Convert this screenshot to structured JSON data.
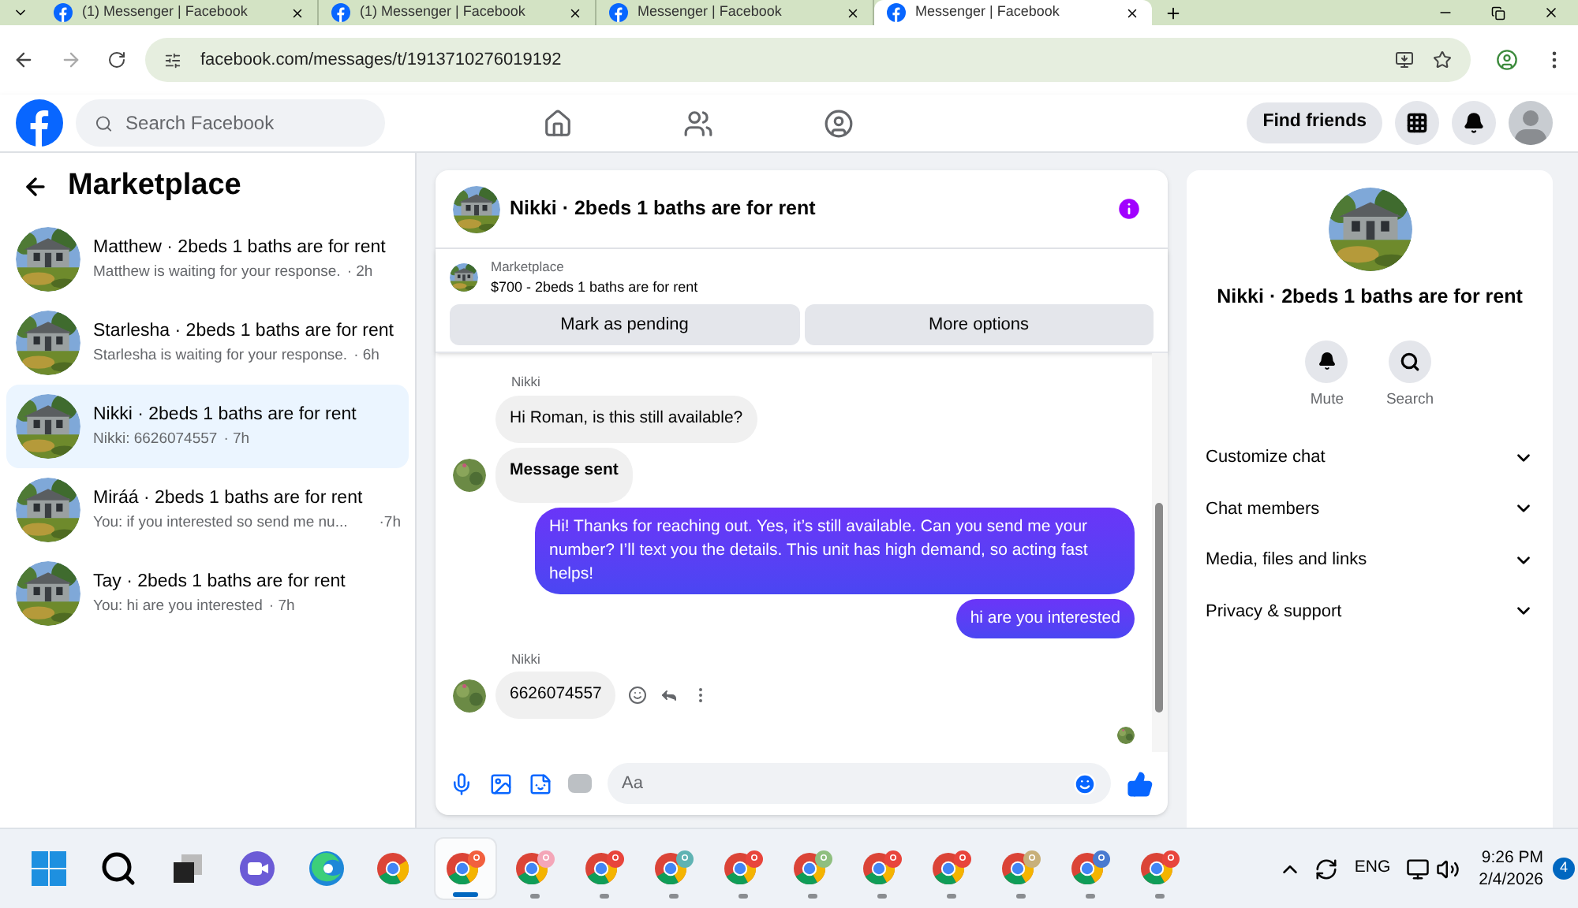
{
  "browser": {
    "tabs": [
      {
        "title": "(1) Messenger | Facebook",
        "selected": false
      },
      {
        "title": "(1) Messenger | Facebook",
        "selected": false
      },
      {
        "title": "Messenger | Facebook",
        "selected": false
      },
      {
        "title": "Messenger | Facebook",
        "selected": true
      }
    ],
    "url": "facebook.com/messages/t/1913710276019192"
  },
  "topbar": {
    "search": {
      "placeholder": "Search Facebook"
    },
    "find_friends": "Find friends"
  },
  "sidebar": {
    "title": "Marketplace",
    "conversations": [
      {
        "title": "Matthew · 2beds 1 baths are for rent",
        "preview": "Matthew is waiting for your response.",
        "time": "· 2h",
        "selected": false
      },
      {
        "title": "Starlesha · 2beds 1 baths are for rent",
        "preview": "Starlesha is waiting for your response.",
        "time": "· 6h",
        "selected": false
      },
      {
        "title": "Nikki · 2beds 1 baths are for rent",
        "preview": "Nikki: 6626074557",
        "time": "· 7h",
        "selected": true
      },
      {
        "title": "Miráá · 2beds 1 baths are for rent",
        "preview": "You: if you interested so send me nu...",
        "time": "·7h",
        "selected": false
      },
      {
        "title": "Tay · 2beds 1 baths are for rent",
        "preview": "You: hi are you interested",
        "time": "· 7h",
        "selected": false
      }
    ]
  },
  "chat": {
    "title": "Nikki · 2beds 1 baths are for rent",
    "listing": {
      "label": "Marketplace",
      "detail": "$700 - 2beds 1 baths are for rent"
    },
    "actions": [
      "Mark as pending",
      "More options"
    ],
    "messages": [
      {
        "kind": "incoming",
        "sender": "Nikki",
        "text": "Hi Roman, is this still available?",
        "avatar": false,
        "emphasis": false
      },
      {
        "kind": "incoming",
        "text": "Message sent",
        "avatar": true,
        "emphasis": true
      },
      {
        "kind": "outgoing",
        "text": "Hi! Thanks for reaching out. Yes, it’s still available. Can you send me your number? I’ll text you the details. This unit has high demand, so acting fast helps!"
      },
      {
        "kind": "outgoing",
        "text": "hi are you interested"
      },
      {
        "kind": "incoming",
        "sender": "Nikki",
        "text": "6626074557",
        "avatar": true,
        "emphasis": false,
        "reactions": true
      }
    ],
    "composer": {
      "placeholder": "Aa"
    }
  },
  "details": {
    "title": "Nikki · 2beds 1 baths are for rent",
    "actions": [
      {
        "kind": "mute",
        "label": "Mute"
      },
      {
        "kind": "search",
        "label": "Search"
      }
    ],
    "sections": [
      {
        "label": "Customize chat",
        "expanded": false
      },
      {
        "label": "Chat members",
        "expanded": false
      },
      {
        "label": "Media, files and links",
        "expanded": false
      },
      {
        "label": "Privacy & support",
        "expanded": false
      }
    ]
  },
  "taskbar": {
    "apps": [
      {
        "kind": "start",
        "running": false,
        "selected": false
      },
      {
        "kind": "search",
        "running": false,
        "selected": false
      },
      {
        "kind": "taskview",
        "running": false,
        "selected": false
      },
      {
        "kind": "meet",
        "running": false,
        "selected": false
      },
      {
        "kind": "edge",
        "running": false,
        "selected": false
      },
      {
        "kind": "chrome",
        "running": false,
        "selected": false
      },
      {
        "kind": "chrome",
        "color": "#f2603f",
        "running": true,
        "selected": true
      },
      {
        "kind": "chrome",
        "color": "#f4a6b8",
        "running": true,
        "selected": false
      },
      {
        "kind": "chrome",
        "color": "#e8453c",
        "running": true,
        "selected": false
      },
      {
        "kind": "chrome",
        "color": "#5fb3b3",
        "running": true,
        "selected": false
      },
      {
        "kind": "chrome",
        "color": "#e8453c",
        "running": true,
        "selected": false
      },
      {
        "kind": "chrome",
        "color": "#8fbf7f",
        "running": true,
        "selected": false
      },
      {
        "kind": "chrome",
        "color": "#e8453c",
        "running": true,
        "selected": false
      },
      {
        "kind": "chrome",
        "color": "#e8453c",
        "running": true,
        "selected": false
      },
      {
        "kind": "chrome",
        "color": "#c8b07a",
        "running": true,
        "selected": false
      },
      {
        "kind": "chrome",
        "color": "#4a7bd0",
        "running": true,
        "selected": false
      },
      {
        "kind": "chrome",
        "color": "#e8453c",
        "running": true,
        "selected": false
      }
    ],
    "language": "ENG",
    "time": "9:26 PM",
    "date": "2/4/2026",
    "notifications": "4"
  }
}
